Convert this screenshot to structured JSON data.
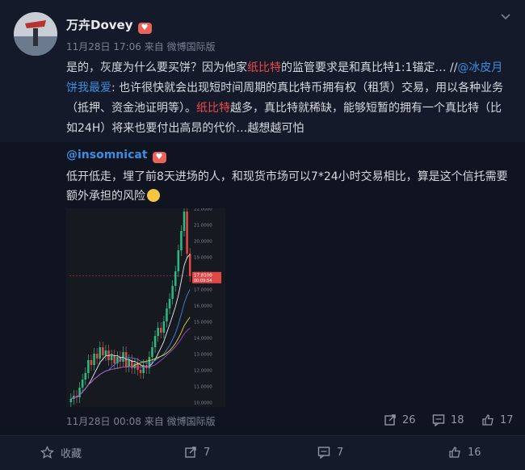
{
  "post": {
    "author": "万卉Dovey",
    "meta": "11月28日 17:06 来自 微博国际版",
    "body_parts": {
      "p1": "是的，灰度为什么要买饼？因为他家",
      "r1": "纸比特",
      "p2": "的监管要求是和真比特1:1锚定… //",
      "l1": "@冰皮月饼我最爱",
      "p3": ": 也许很快就会出现短时间周期的真比特币拥有权（租赁）交易，用以各种业务（抵押、资金池证明等）。",
      "r2": "纸比特",
      "p4": "越多，真比特就稀缺，能够短暂的拥有一个真比特（比如24H）将来也要付出高昂的代价…越想越可怕"
    }
  },
  "repost": {
    "author": "@insomnicat",
    "text": "低开低走，埋了前8天进场的人，和现货市场可以7*24小时交易相比，算是这个信托需要额外承担的风险",
    "meta": "11月28日 00:08 来自 微博国际版",
    "share_count": "26",
    "comment_count": "18",
    "like_count": "17"
  },
  "chart_data": {
    "type": "candlestick",
    "y_ticks": [
      "22.0000",
      "21.0000",
      "20.0000",
      "19.0000",
      "18.0000",
      "17.0000",
      "16.0000",
      "15.0000",
      "14.0000",
      "13.0000",
      "12.0000",
      "11.0000",
      "10.0000"
    ],
    "ylim": [
      10,
      22
    ],
    "last_price": "17.8100",
    "countdown": "00:09:54",
    "closes": [
      10.2,
      10.4,
      10.3,
      10.9,
      11.4,
      11.8,
      12.6,
      12.3,
      13.0,
      12.7,
      13.4,
      12.9,
      13.2,
      12.6,
      12.9,
      12.4,
      12.8,
      12.5,
      13.1,
      12.2,
      12.6,
      12.1,
      12.4,
      12.0,
      11.8,
      12.3,
      12.1,
      12.8,
      13.4,
      14.1,
      14.6,
      14.3,
      15.0,
      15.8,
      16.4,
      17.2,
      18.1,
      19.4,
      20.6,
      21.8,
      19.2,
      17.8
    ]
  },
  "footer": {
    "collect_label": "收藏",
    "share_count": "7",
    "comment_count": "7",
    "like_count": "16"
  },
  "colors": {
    "link": "#3c8dde",
    "highlight": "#f04848",
    "up": "#2db982",
    "down": "#e04848"
  }
}
